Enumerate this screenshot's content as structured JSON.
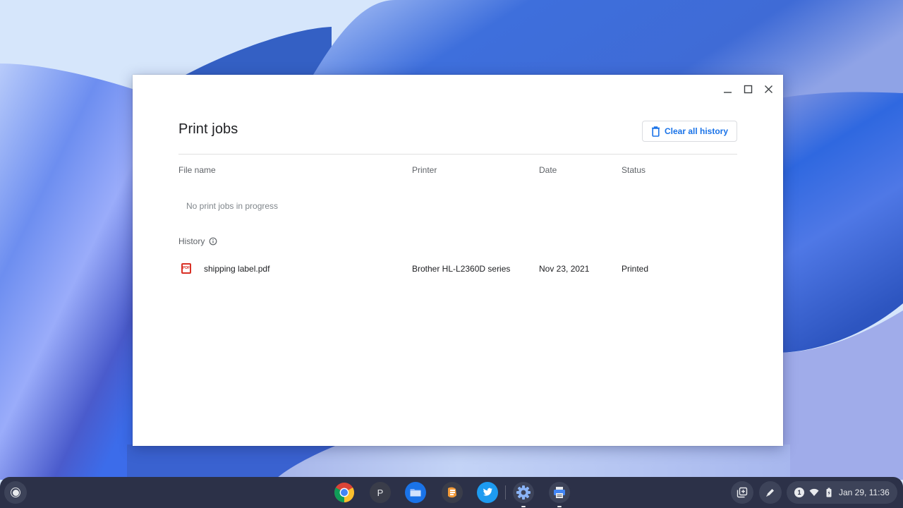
{
  "window": {
    "title": "Print jobs",
    "controls": {
      "minimize": "minimize",
      "maximize": "maximize",
      "close": "close"
    },
    "clear_button_label": "Clear all history",
    "columns": [
      "File name",
      "Printer",
      "Date",
      "Status"
    ],
    "in_progress_empty_message": "No print jobs in progress",
    "history_label": "History",
    "history": [
      {
        "file_name": "shipping label.pdf",
        "file_icon": "pdf-icon",
        "file_icon_text": "PDF",
        "printer": "Brother HL-L2360D series",
        "date": "Nov 23, 2021",
        "status": "Printed"
      }
    ],
    "accent_color": "#1a73e8",
    "pdf_icon_color": "#d93025"
  },
  "shelf": {
    "apps": [
      {
        "name": "Chrome",
        "icon": "chrome-icon",
        "letter": ""
      },
      {
        "name": "P",
        "icon": "letter-p-icon",
        "letter": "P"
      },
      {
        "name": "Files",
        "icon": "files-icon",
        "letter": ""
      },
      {
        "name": "App",
        "icon": "app-icon",
        "letter": ""
      },
      {
        "name": "Twitter",
        "icon": "twitter-icon",
        "letter": ""
      },
      {
        "name": "Settings",
        "icon": "settings-icon",
        "letter": "",
        "running": true
      },
      {
        "name": "Print jobs",
        "icon": "printer-icon",
        "letter": "",
        "running": true
      }
    ],
    "tray": {
      "notification_count": "1",
      "datetime": "Jan 29, 11:36"
    }
  }
}
